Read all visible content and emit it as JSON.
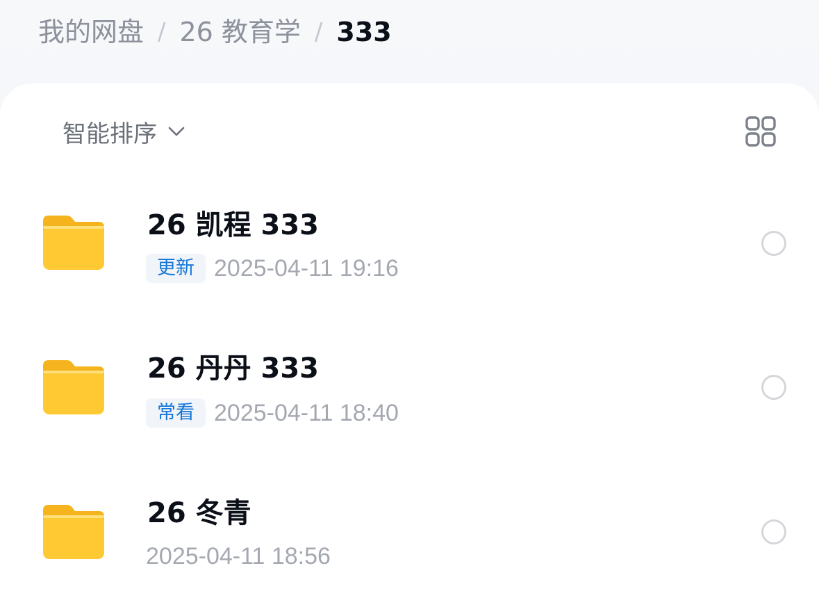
{
  "breadcrumb": {
    "items": [
      "我的网盘",
      "26 教育学"
    ],
    "separator": "/",
    "current": "333"
  },
  "toolbar": {
    "sort_label": "智能排序",
    "sort_icon": "chevron-down-icon",
    "view_icon": "grid-view-icon"
  },
  "files": [
    {
      "name": "26 凯程 333",
      "tag": "更新",
      "time": "2025-04-11 19:16",
      "icon": "folder-icon"
    },
    {
      "name": "26 丹丹 333",
      "tag": "常看",
      "time": "2025-04-11 18:40",
      "icon": "folder-icon"
    },
    {
      "name": "26 冬青",
      "tag": "",
      "time": "2025-04-11 18:56",
      "icon": "folder-icon"
    }
  ],
  "colors": {
    "folder": "#ffc933",
    "tag_text": "#1677d8",
    "tag_bg": "#f1f4f8",
    "title": "#0b0f17",
    "muted": "#a4a8b0"
  }
}
